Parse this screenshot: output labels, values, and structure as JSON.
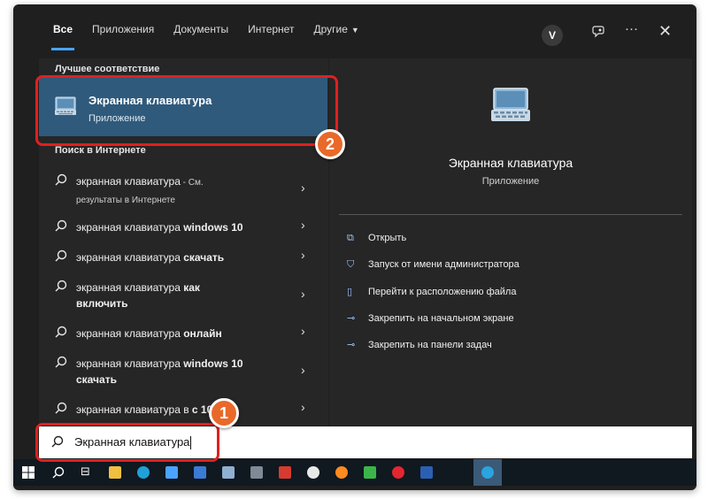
{
  "filters": {
    "all": "Все",
    "apps": "Приложения",
    "docs": "Документы",
    "web": "Интернет",
    "other": "Другие"
  },
  "topbar": {
    "avatar_letter": "V"
  },
  "left": {
    "best_match_header": "Лучшее соответствие",
    "best_match": {
      "title": "Экранная клавиатура",
      "subtitle": "Приложение"
    },
    "web_header": "Поиск в Интернете",
    "web_items": [
      {
        "prefix": "экранная клавиатура",
        "bold": "",
        "suffix": " - См.",
        "line2": "результаты в Интернете"
      },
      {
        "prefix": "экранная клавиатура ",
        "bold": "windows 10",
        "suffix": "",
        "line2": ""
      },
      {
        "prefix": "экранная клавиатура ",
        "bold": "скачать",
        "suffix": "",
        "line2": ""
      },
      {
        "prefix": "экранная клавиатура ",
        "bold": "как",
        "suffix": "",
        "line2": "включить"
      },
      {
        "prefix": "экранная клавиатура ",
        "bold": "онлайн",
        "suffix": "",
        "line2": ""
      },
      {
        "prefix": "экранная клавиатура ",
        "bold": "windows 10",
        "suffix": "",
        "line2": "скачать"
      },
      {
        "prefix": "экранная клавиатура в",
        "bold": "",
        "suffix": "  с 10",
        "line2": ""
      }
    ]
  },
  "right": {
    "title": "Экранная клавиатура",
    "subtitle": "Приложение",
    "actions": [
      "Открыть",
      "Запуск от имени администратора",
      "Перейти к расположению файла",
      "Закрепить на начальном экране",
      "Закрепить на панели задач"
    ]
  },
  "search": {
    "value": "Экранная клавиатура"
  },
  "annotations": {
    "badge1": "1",
    "badge2": "2"
  },
  "colors": {
    "accent": "#4aa3ff",
    "best_match_bg": "#2f5a7c",
    "highlight": "#e02020",
    "badge": "#e8692a"
  }
}
